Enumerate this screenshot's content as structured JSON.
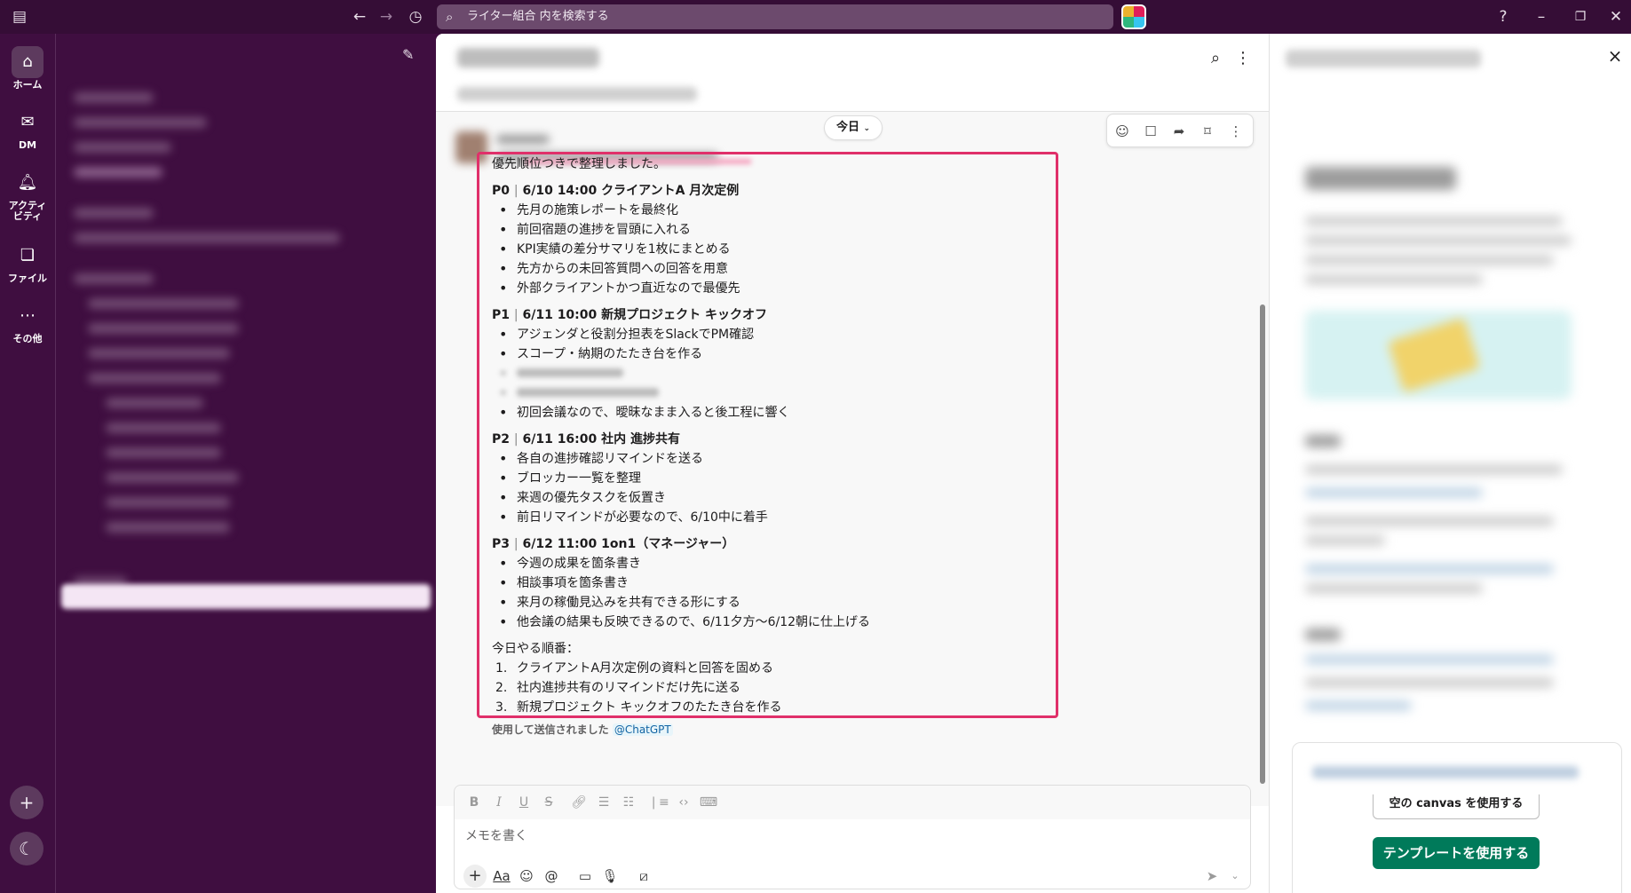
{
  "topbar": {
    "search_placeholder": "ライター組合 内を検索する"
  },
  "rail": {
    "items": [
      {
        "label": "ホーム",
        "icon": "home-icon"
      },
      {
        "label": "DM",
        "icon": "dm-icon"
      },
      {
        "label": "アクティ\nビティ",
        "icon": "bell-icon"
      },
      {
        "label": "ファイル",
        "icon": "files-icon"
      },
      {
        "label": "その他",
        "icon": "more-icon"
      }
    ]
  },
  "channel": {
    "date_pill": "今日"
  },
  "message": {
    "intro": "優先順位つきで整理しました。",
    "sections": [
      {
        "priority": "P0",
        "title": "6/10 14:00 クライアントA 月次定例",
        "bullets": [
          "先月の施策レポートを最終化",
          "前回宿題の進捗を冒頭に入れる",
          "KPI実績の差分サマリを1枚にまとめる",
          "先方からの未回答質問への回答を用意",
          "外部クライアントかつ直近なので最優先"
        ]
      },
      {
        "priority": "P1",
        "title": "6/11 10:00 新規プロジェクト キックオフ",
        "bullets": [
          "アジェンダと役割分担表をSlackでPM確認",
          "スコープ・納期のたたき台を作る",
          "",
          "",
          "初回会議なので、曖昧なまま入ると後工程に響く"
        ]
      },
      {
        "priority": "P2",
        "title": "6/11 16:00 社内 進捗共有",
        "bullets": [
          "各自の進捗確認リマインドを送る",
          "ブロッカー一覧を整理",
          "来週の優先タスクを仮置き",
          "前日リマインドが必要なので、6/10中に着手"
        ]
      },
      {
        "priority": "P3",
        "title": "6/12 11:00 1on1（マネージャー）",
        "bullets": [
          "今週の成果を箇条書き",
          "相談事項を箇条書き",
          "来月の稼働見込みを共有できる形にする",
          "他会議の結果も反映できるので、6/11夕方〜6/12朝に仕上げる"
        ]
      }
    ],
    "order_heading": "今日やる順番：",
    "order": [
      "クライアントA月次定例の資料と回答を固める",
      "社内進捗共有のリマインドだけ先に送る",
      "新規プロジェクト キックオフのたたき台を作る"
    ],
    "sent_using": "使用して送信されました",
    "mention": "@ChatGPT"
  },
  "composer": {
    "placeholder": "メモを書く"
  },
  "right_panel": {
    "template_button": "テンプレートを使用する",
    "blank_canvas_button": "空の canvas を使用する"
  },
  "colors": {
    "aubergine": "#3f0e40",
    "highlight_border": "#e0306a",
    "primary_button": "#007a5a"
  }
}
